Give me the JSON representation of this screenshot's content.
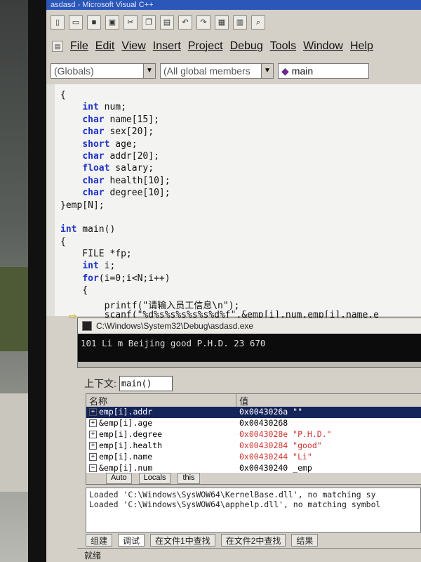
{
  "window": {
    "title": "asdasd - Microsoft Visual C++"
  },
  "menu": [
    "File",
    "Edit",
    "View",
    "Insert",
    "Project",
    "Debug",
    "Tools",
    "Window",
    "Help"
  ],
  "wizard": {
    "scope": "(Globals)",
    "members": "(All global members",
    "function": "main"
  },
  "code": [
    "{",
    "    int num;",
    "    char name[15];",
    "    char sex[20];",
    "    short age;",
    "    char addr[20];",
    "    float salary;",
    "    char health[10];",
    "    char degree[10];",
    "}emp[N];",
    "",
    "int main()",
    "{",
    "    FILE *fp;",
    "    int i;",
    "    for(i=0;i<N;i++)",
    "    {",
    "        printf(\"请输入员工信息\\n\");",
    "        scanf(\"%d%s%s%s%s%s%d%f\",&emp[i].num,emp[i].name,e"
  ],
  "console": {
    "title": "C:\\Windows\\System32\\Debug\\asdasd.exe",
    "output": "101 Li m Beijing good P.H.D.  23 670"
  },
  "context": {
    "label": "上下文:",
    "value": "main()"
  },
  "watch": {
    "headers": [
      "名称",
      "值"
    ],
    "rows": [
      {
        "name": "emp[i].addr",
        "value": "0x0043026a \"\"",
        "changed": false,
        "selected": true
      },
      {
        "name": "&emp[i].age",
        "value": "0x00430268",
        "changed": false
      },
      {
        "name": "emp[i].degree",
        "value": "0x0043028e \"P.H.D.\"",
        "changed": true
      },
      {
        "name": "emp[i].health",
        "value": "0x00430284 \"good\"",
        "changed": true
      },
      {
        "name": "emp[i].name",
        "value": "0x00430244 \"Li\"",
        "changed": true
      },
      {
        "name": "&emp[i].num",
        "value": "0x00430240 _emp",
        "changed": false
      }
    ],
    "tabs": [
      "Auto",
      "Locals",
      "this"
    ]
  },
  "output": {
    "lines": [
      "Loaded 'C:\\Windows\\SysWOW64\\KernelBase.dll', no matching sy",
      "Loaded 'C:\\Windows\\SysWOW64\\apphelp.dll', no matching symbol"
    ],
    "tabs": [
      "组建",
      "调试",
      "在文件1中查找",
      "在文件2中查找",
      "结果"
    ]
  },
  "status": "就绪"
}
